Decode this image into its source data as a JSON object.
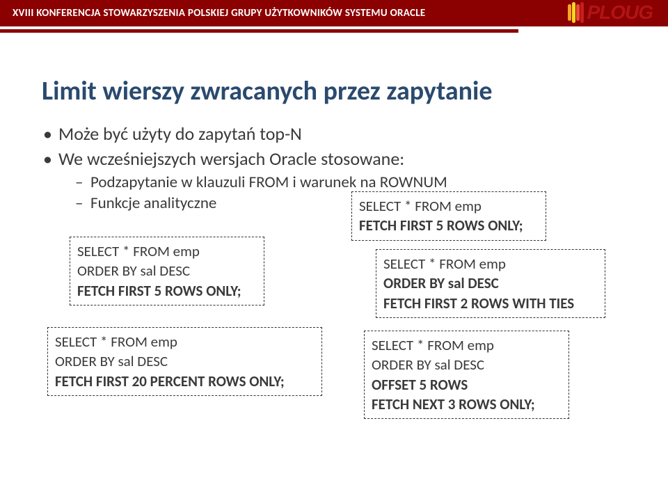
{
  "header": {
    "conference": "XVIII KONFERENCJA STOWARZYSZENIA POLSKIEJ  GRUPY UŻYTKOWNIKÓW SYSTEMU ORACLE",
    "logo_text": "PLOUG"
  },
  "title": "Limit wierszy zwracanych przez zapytanie",
  "bullets": [
    "Może być użyty do zapytań top-N",
    "We wcześniejszych wersjach Oracle stosowane:"
  ],
  "sub_bullets": [
    "Podzapytanie w klauzuli FROM i warunek na ROWNUM",
    "Funkcje analityczne"
  ],
  "codeboxes": {
    "box1": {
      "l1": "SELECT * FROM emp",
      "l2": "ORDER BY sal DESC",
      "l3": "FETCH FIRST 5 ROWS ONLY;"
    },
    "box2": {
      "l1": "SELECT * FROM emp",
      "l2": "ORDER BY sal DESC",
      "l3": "FETCH FIRST 20 PERCENT ROWS ONLY;"
    },
    "box3": {
      "l1": "SELECT * FROM emp",
      "l2": "FETCH FIRST 5 ROWS ONLY;"
    },
    "box4": {
      "l1": "SELECT * FROM emp",
      "l2": "ORDER BY sal DESC",
      "l3": "FETCH FIRST 2 ROWS WITH TIES"
    },
    "box5": {
      "l1": "SELECT * FROM emp",
      "l2": "ORDER BY sal DESC",
      "l3": "OFFSET 5 ROWS",
      "l4": "FETCH NEXT 3 ROWS ONLY;"
    }
  }
}
